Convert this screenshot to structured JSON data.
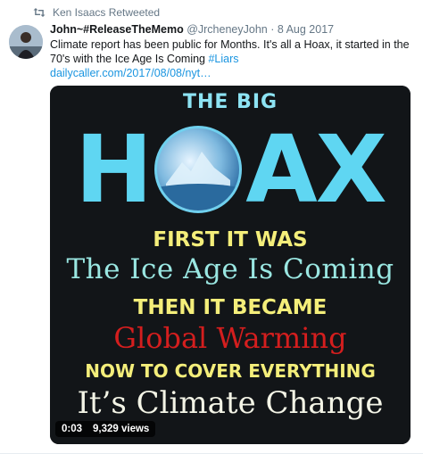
{
  "retweet": {
    "icon": "retweet-icon",
    "text": "Ken Isaacs Retweeted"
  },
  "tweet": {
    "display_name": "John~#ReleaseTheMemo",
    "handle": "@JrcheneyJohn",
    "separator": "·",
    "date": "8 Aug 2017",
    "text_main": "Climate report has been public for Months. It's all a Hoax, it started in the 70's with the Ice Age Is Coming ",
    "hashtag": "#Liars",
    "link": "dailycaller.com/2017/08/08/nyt…"
  },
  "media": {
    "line_1": "THE BIG",
    "hoax_h": "H",
    "hoax_ax": "AX",
    "line_2": "FIRST IT WAS",
    "line_3": "The Ice Age Is Coming",
    "line_4": "THEN IT BECAME",
    "line_5": "Global Warming",
    "line_6": "NOW TO COVER EVERYTHING",
    "line_7": "It’s Climate Change",
    "duration": "0:03",
    "views": "9,329 views"
  },
  "colors": {
    "link": "#1b95e0",
    "meta": "#657786",
    "hoax_blue": "#5fd6f2",
    "yellow_text": "#f4ee7a",
    "red_text": "#d41e1e"
  }
}
